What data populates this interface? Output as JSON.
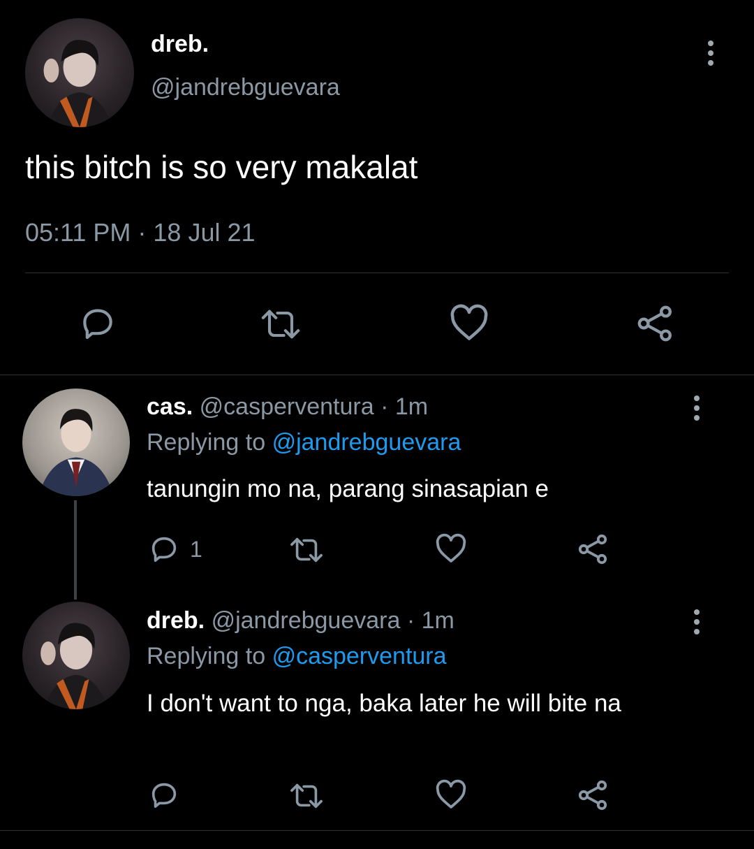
{
  "main_tweet": {
    "display_name": "dreb.",
    "handle": "@jandrebguevara",
    "text": "this bitch is so very makalat",
    "timestamp": "05:11 PM · 18 Jul 21"
  },
  "replies": [
    {
      "display_name": "cas.",
      "handle": "@casperventura",
      "time": "· 1m",
      "replying_label": "Replying to",
      "replying_to": "@jandrebguevara",
      "text": "tanungin mo na, parang sinasapian e",
      "reply_count": "1"
    },
    {
      "display_name": "dreb.",
      "handle": "@jandrebguevara",
      "time": "· 1m",
      "replying_label": "Replying to",
      "replying_to": "@casperventura",
      "text": "I don't want to nga, baka later he will bite na"
    }
  ],
  "colors": {
    "background": "#000000",
    "text": "#ffffff",
    "muted": "#8b98a5",
    "link": "#1d9bf0",
    "divider": "#2f3336"
  },
  "icons": [
    "reply-icon",
    "retweet-icon",
    "like-icon",
    "share-icon",
    "more-options-icon"
  ]
}
